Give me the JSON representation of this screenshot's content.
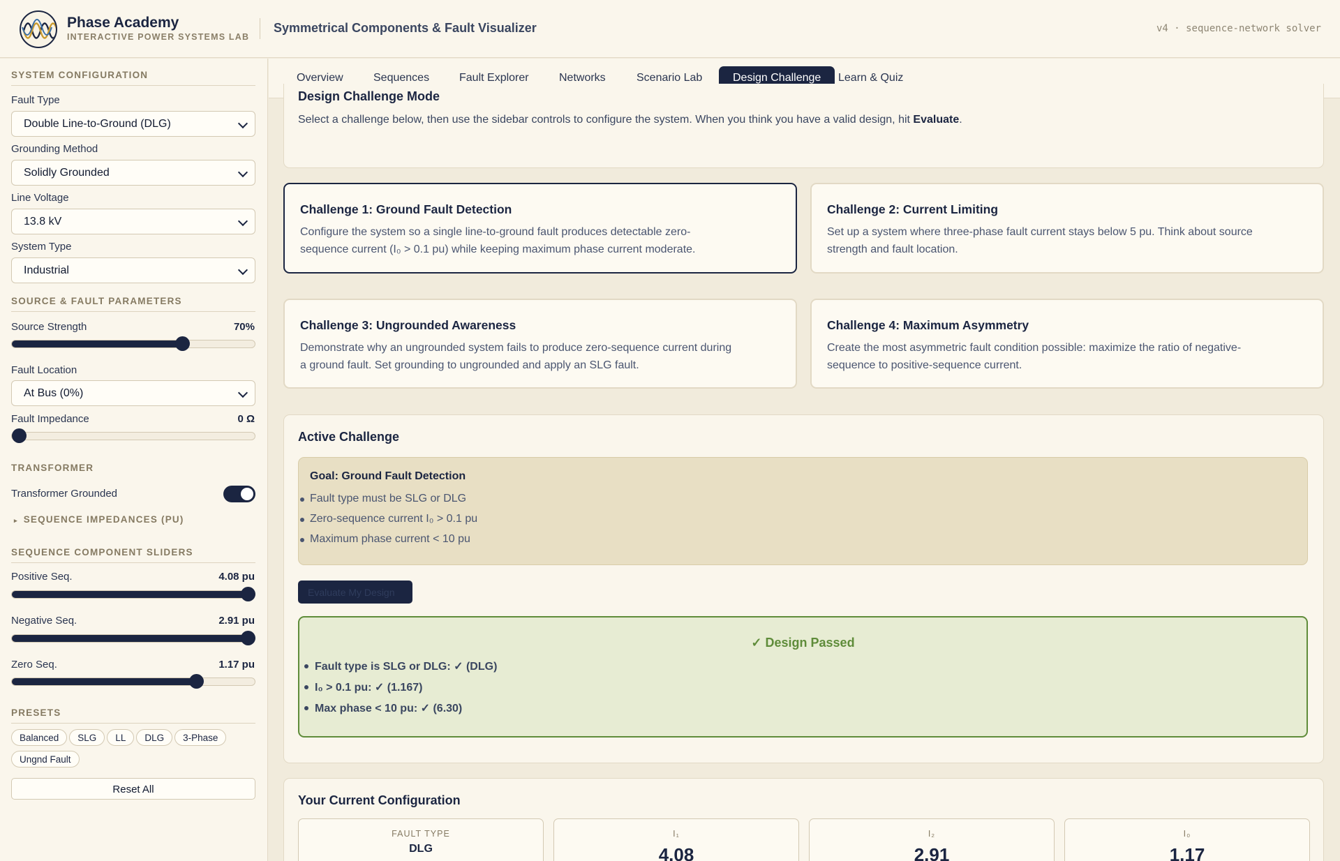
{
  "header": {
    "brand_name": "Phase Academy",
    "brand_sub": "INTERACTIVE POWER SYSTEMS LAB",
    "app_title": "Symmetrical Components & Fault Visualizer",
    "version": "v4 · sequence-network solver"
  },
  "sidebar": {
    "system_config": {
      "heading": "SYSTEM CONFIGURATION",
      "fault_type_label": "Fault Type",
      "fault_type_value": "Double Line-to-Ground (DLG)",
      "grounding_label": "Grounding Method",
      "grounding_value": "Solidly Grounded",
      "line_voltage_label": "Line Voltage",
      "line_voltage_value": "13.8 kV",
      "system_type_label": "System Type",
      "system_type_value": "Industrial"
    },
    "source_fault": {
      "heading": "SOURCE & FAULT PARAMETERS",
      "source_strength_label": "Source Strength",
      "source_strength_value": "70%",
      "source_strength_level": 0.7,
      "fault_location_label": "Fault Location",
      "fault_location_value": "At Bus (0%)",
      "fault_impedance_label": "Fault Impedance",
      "fault_impedance_value": "0 Ω",
      "fault_impedance_level": 0
    },
    "transformer": {
      "heading": "TRANSFORMER",
      "grounded_label": "Transformer Grounded",
      "grounded_on": true,
      "seq_impedances_label": "SEQUENCE IMPEDANCES (PU)"
    },
    "sequence_sliders": {
      "heading": "SEQUENCE COMPONENT SLIDERS",
      "positive_label": "Positive Seq.",
      "positive_value": "4.08 pu",
      "positive_level": 1.0,
      "negative_label": "Negative Seq.",
      "negative_value": "2.91 pu",
      "negative_level": 1.0,
      "zero_label": "Zero Seq.",
      "zero_value": "1.17 pu",
      "zero_level": 0.76
    },
    "presets": {
      "heading": "PRESETS",
      "items": [
        "Balanced",
        "SLG",
        "LL",
        "DLG",
        "3-Phase",
        "Ungnd Fault"
      ],
      "reset_label": "Reset All"
    }
  },
  "tabs": [
    "Overview",
    "Sequences",
    "Fault Explorer",
    "Networks",
    "Scenario Lab",
    "Design Challenge",
    "Learn & Quiz"
  ],
  "active_tab": "Design Challenge",
  "intro": {
    "title": "Design Challenge Mode",
    "text": "Select a challenge below, then use the sidebar controls to configure the system. When you think you have a valid design, hit ",
    "text_bold": "Evaluate",
    "text_end": "."
  },
  "challenges": [
    {
      "title": "Challenge 1: Ground Fault Detection",
      "line1": "Configure the system so a single line-to-ground fault produces detectable zero-",
      "line2": "sequence current (I₀ > 0.1 pu) while keeping maximum phase current moderate."
    },
    {
      "title": "Challenge 2: Current Limiting",
      "line1": "Set up a system where three-phase fault current stays below 5 pu. Think about source",
      "line2": "strength and fault location."
    },
    {
      "title": "Challenge 3: Ungrounded Awareness",
      "line1": "Demonstrate why an ungrounded system fails to produce zero-sequence current during",
      "line2": "a ground fault. Set grounding to ungrounded and apply an SLG fault."
    },
    {
      "title": "Challenge 4: Maximum Asymmetry",
      "line1": "Create the most asymmetric fault condition possible: maximize the ratio of negative-",
      "line2": "sequence to positive-sequence current."
    }
  ],
  "active_challenge": {
    "title": "Active Challenge",
    "goal_title": "Goal: Ground Fault Detection",
    "goals": [
      "Fault type must be SLG or DLG",
      "Zero-sequence current I₀ > 0.1 pu",
      "Maximum phase current < 10 pu"
    ],
    "evaluate_label": "Evaluate My Design",
    "result_title": "✓ Design Passed",
    "results": [
      "Fault type is SLG or DLG: ✓ (DLG)",
      "I₀ > 0.1 pu: ✓ (1.167)",
      "Max phase < 10 pu: ✓ (6.30)"
    ]
  },
  "current_config": {
    "title": "Your Current Configuration",
    "metrics": [
      {
        "label": "FAULT TYPE",
        "value": "DLG"
      },
      {
        "label": "I₁",
        "value": "4.08"
      },
      {
        "label": "I₂",
        "value": "2.91"
      },
      {
        "label": "I₀",
        "value": "1.17"
      }
    ]
  },
  "colors": {
    "navy": "#1b2541",
    "cream": "#faf6ec",
    "pass_green": "#5f8c3a",
    "goal_bg": "#e8dfc4"
  }
}
